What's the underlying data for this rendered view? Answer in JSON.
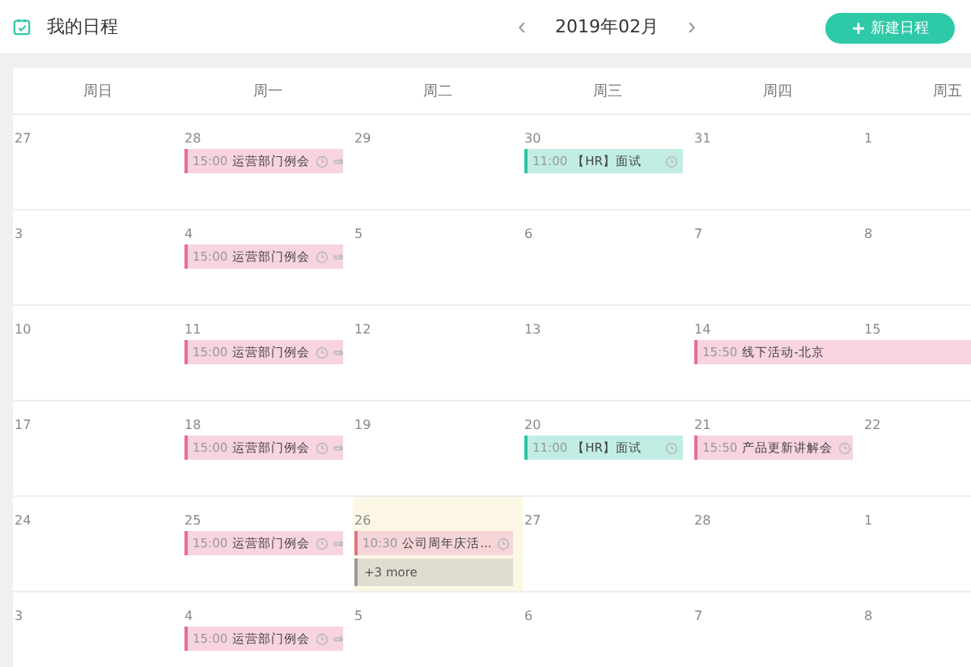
{
  "header": {
    "title": "我的日程",
    "prev": "‹",
    "month": "2019年02月",
    "next": "›",
    "new_button": {
      "icon": "+",
      "label": "新建日程"
    }
  },
  "weekdays": [
    "周日",
    "周一",
    "周二",
    "周三",
    "周四",
    "周五"
  ],
  "weeks": [
    {
      "days": [
        {
          "date": "27",
          "today": false
        },
        {
          "date": "28",
          "today": false,
          "events": [
            {
              "kind": "event",
              "time": "15:00",
              "title": "运营部门例会",
              "color": "#e86b9c",
              "reminder": true,
              "repeat": true,
              "continues": false
            }
          ]
        },
        {
          "date": "29",
          "today": false
        },
        {
          "date": "30",
          "today": false,
          "events": [
            {
              "kind": "event",
              "time": "11:00",
              "title": "【HR】面试",
              "color": "#2fc4a6",
              "reminder": true,
              "repeat": false,
              "continues": false
            }
          ]
        },
        {
          "date": "31",
          "today": false
        },
        {
          "date": "1",
          "today": false
        }
      ]
    },
    {
      "days": [
        {
          "date": "3",
          "today": false
        },
        {
          "date": "4",
          "today": false,
          "events": [
            {
              "kind": "event",
              "time": "15:00",
              "title": "运营部门例会",
              "color": "#e86b9c",
              "reminder": true,
              "repeat": true,
              "continues": false
            }
          ]
        },
        {
          "date": "5",
          "today": false
        },
        {
          "date": "6",
          "today": false
        },
        {
          "date": "7",
          "today": false
        },
        {
          "date": "8",
          "today": false
        }
      ]
    },
    {
      "days": [
        {
          "date": "10",
          "today": false
        },
        {
          "date": "11",
          "today": false,
          "events": [
            {
              "kind": "event",
              "time": "15:00",
              "title": "运营部门例会",
              "color": "#e86b9c",
              "reminder": true,
              "repeat": true,
              "continues": false
            }
          ]
        },
        {
          "date": "12",
          "today": false
        },
        {
          "date": "13",
          "today": false
        },
        {
          "date": "14",
          "today": false,
          "events": [
            {
              "kind": "event",
              "time": "15:50",
              "title": "线下活动-北京",
              "color": "#e86b9c",
              "continues": true
            }
          ]
        },
        {
          "date": "15",
          "today": false
        }
      ]
    },
    {
      "days": [
        {
          "date": "17",
          "today": false
        },
        {
          "date": "18",
          "today": false,
          "events": [
            {
              "kind": "event",
              "time": "15:00",
              "title": "运营部门例会",
              "color": "#e86b9c",
              "reminder": true,
              "repeat": true,
              "continues": false
            }
          ]
        },
        {
          "date": "19",
          "today": false
        },
        {
          "date": "20",
          "today": false,
          "events": [
            {
              "kind": "event",
              "time": "11:00",
              "title": "【HR】面试",
              "color": "#2fc4a6",
              "reminder": true,
              "repeat": false,
              "continues": false
            }
          ]
        },
        {
          "date": "21",
          "today": false,
          "events": [
            {
              "kind": "event",
              "time": "15:50",
              "title": "产品更新讲解会",
              "color": "#e86b9c",
              "reminder": true,
              "repeat": false,
              "continues": false
            }
          ]
        },
        {
          "date": "22",
          "today": false
        }
      ]
    },
    {
      "days": [
        {
          "date": "24",
          "today": false
        },
        {
          "date": "25",
          "today": false,
          "events": [
            {
              "kind": "event",
              "time": "15:00",
              "title": "运营部门例会",
              "color": "#e86b9c",
              "reminder": true,
              "repeat": true,
              "continues": false
            }
          ]
        },
        {
          "date": "26",
          "today": true,
          "events": [
            {
              "kind": "event",
              "time": "10:30",
              "title": "公司周年庆活...",
              "color": "#e2737f",
              "reminder": true,
              "repeat": false,
              "continues": false
            },
            {
              "kind": "more",
              "title": "+3 more"
            }
          ]
        },
        {
          "date": "27",
          "today": false
        },
        {
          "date": "28",
          "today": false
        },
        {
          "date": "1",
          "today": false
        }
      ]
    },
    {
      "days": [
        {
          "date": "3",
          "today": false
        },
        {
          "date": "4",
          "today": false,
          "events": [
            {
              "kind": "event",
              "time": "15:00",
              "title": "运营部门例会",
              "color": "#e86b9c",
              "reminder": true,
              "repeat": true,
              "continues": false
            }
          ]
        },
        {
          "date": "5",
          "today": false
        },
        {
          "date": "6",
          "today": false
        },
        {
          "date": "7",
          "today": false
        },
        {
          "date": "8",
          "today": false
        }
      ]
    }
  ]
}
